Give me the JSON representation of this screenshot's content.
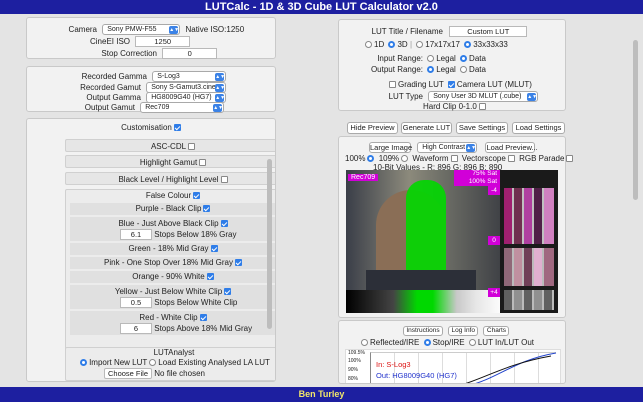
{
  "app": {
    "title": "LUTCalc - 1D & 3D Cube LUT Calculator v2.0",
    "author": "Ben Turley"
  },
  "camera": {
    "label": "Camera",
    "value": "Sony PMW-F55",
    "native_iso": "Native ISO:1250",
    "cineei_label": "CineEI ISO",
    "cineei_value": "1250",
    "stop_label": "Stop Correction",
    "stop_value": "0"
  },
  "gamma": {
    "rec_gamma_label": "Recorded Gamma",
    "rec_gamma": "S-Log3",
    "rec_gamut_label": "Recorded Gamut",
    "rec_gamut": "Sony S-Gamut3.cine",
    "out_gamma_label": "Output Gamma",
    "out_gamma": "HG8009G40 (HG7)",
    "out_gamut_label": "Output Gamut",
    "out_gamut": "Rec709"
  },
  "custom": {
    "label": "Customisation",
    "asc_cdl": "ASC-CDL",
    "highlight_gamut": "Highlight Gamut",
    "black_level": "Black Level / Highlight Level",
    "false_colour": "False Colour",
    "purple": "Purple - Black Clip",
    "blue": "Blue - Just Above Black Clip",
    "blue_value": "6.1",
    "blue_unit": "Stops Below 18% Gray",
    "green": "Green - 18% Mid Gray",
    "pink": "Pink - One Stop Over 18% Mid Gray",
    "orange": "Orange - 90% White",
    "yellow": "Yellow - Just Below White Clip",
    "yellow_value": "0.5",
    "yellow_unit": "Stops Below White Clip",
    "red": "Red - White Clip",
    "red_value": "6",
    "red_unit": "Stops Above 18% Mid Gray",
    "lutanalyst": "LUTAnalyst",
    "import_new": "Import New LUT",
    "load_existing": "Load Existing Analysed LA LUT",
    "choose_file": "Choose File",
    "no_file": "No file chosen"
  },
  "lut": {
    "title_label": "LUT Title / Filename",
    "title_value": "Custom LUT",
    "d1": "1D",
    "d3": "3D",
    "size17": "17x17x17",
    "size33": "33x33x33",
    "input_range": "Input Range:",
    "output_range": "Output Range:",
    "legal": "Legal",
    "data": "Data",
    "grading_lut": "Grading LUT",
    "camera_lut": "Camera LUT (MLUT)",
    "lut_type_label": "LUT Type",
    "lut_type": "Sony User 3D MLUT (.cube)",
    "hard_clip": "Hard Clip 0-1.0"
  },
  "actions": {
    "hide_preview": "Hide Preview",
    "generate": "Generate LUT",
    "save_settings": "Save Settings",
    "load_settings": "Load Settings"
  },
  "preview": {
    "large_image": "Large Image",
    "contrast": "High Contrast",
    "load_preview": "Load Preview...",
    "p100": "100%",
    "p109": "109%",
    "waveform": "Waveform",
    "vectorscope": "Vectorscope",
    "rgb_parade": "RGB Parade",
    "values": "10-Bit Values - R:  896  G:  896  B:  890",
    "tag_rec709": "Rec709",
    "sat75": "75% Sat",
    "sat100": "100% Sat",
    "m4": "-4",
    "zero": "0",
    "p4": "+4"
  },
  "info": {
    "instructions": "Instructions",
    "log_info": "Log Info",
    "charts": "Charts",
    "reflected": "Reflected/IRE",
    "stop_ire": "Stop/IRE",
    "lut_in_out": "LUT In/LUT Out",
    "y_top": "109.5%",
    "y_2": "100%",
    "y_3": "90%",
    "y_4": "80%",
    "in_label": "In: S-Log3",
    "out_label": "Out: HG8009G40 (HG7)"
  },
  "colors": {
    "title_bar": "#1d1fa0",
    "accent": "#2f7de8",
    "false_green": "#00d800",
    "magenta": "#d100d8",
    "author": "#f2e66b"
  }
}
